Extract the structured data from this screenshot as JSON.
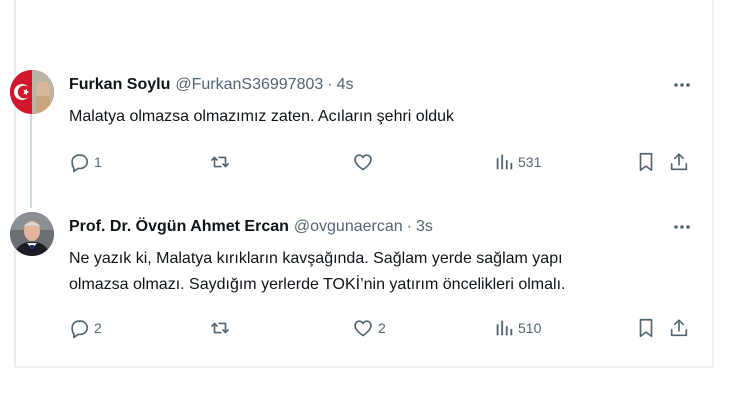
{
  "colors": {
    "text": "#0f1419",
    "muted": "#536471",
    "thread_line": "#cfd9de"
  },
  "tweets": [
    {
      "author_name": "Furkan Soylu",
      "handle": "@FurkanS36997803",
      "separator": "·",
      "time": "4s",
      "text_lines": [
        "Malatya olmazsa olmazımız zaten. Acıların şehri olduk"
      ],
      "reply_count": "1",
      "retweet_count": "",
      "like_count": "",
      "view_count": "531",
      "avatar_icon": "turkish-flag-avatar"
    },
    {
      "author_name": "Prof. Dr. Övgün Ahmet Ercan",
      "handle": "@ovgunaercan",
      "separator": "·",
      "time": "3s",
      "text_lines": [
        "Ne yazık ki, Malatya kırıkların kavşağında. Sağlam yerde sağlam yapı",
        "olmazsa olmazı. Saydığım yerlerde TOKİ’nin yatırım öncelikleri olmalı."
      ],
      "reply_count": "2",
      "retweet_count": "",
      "like_count": "2",
      "view_count": "510",
      "avatar_icon": "person-portrait-avatar"
    }
  ]
}
